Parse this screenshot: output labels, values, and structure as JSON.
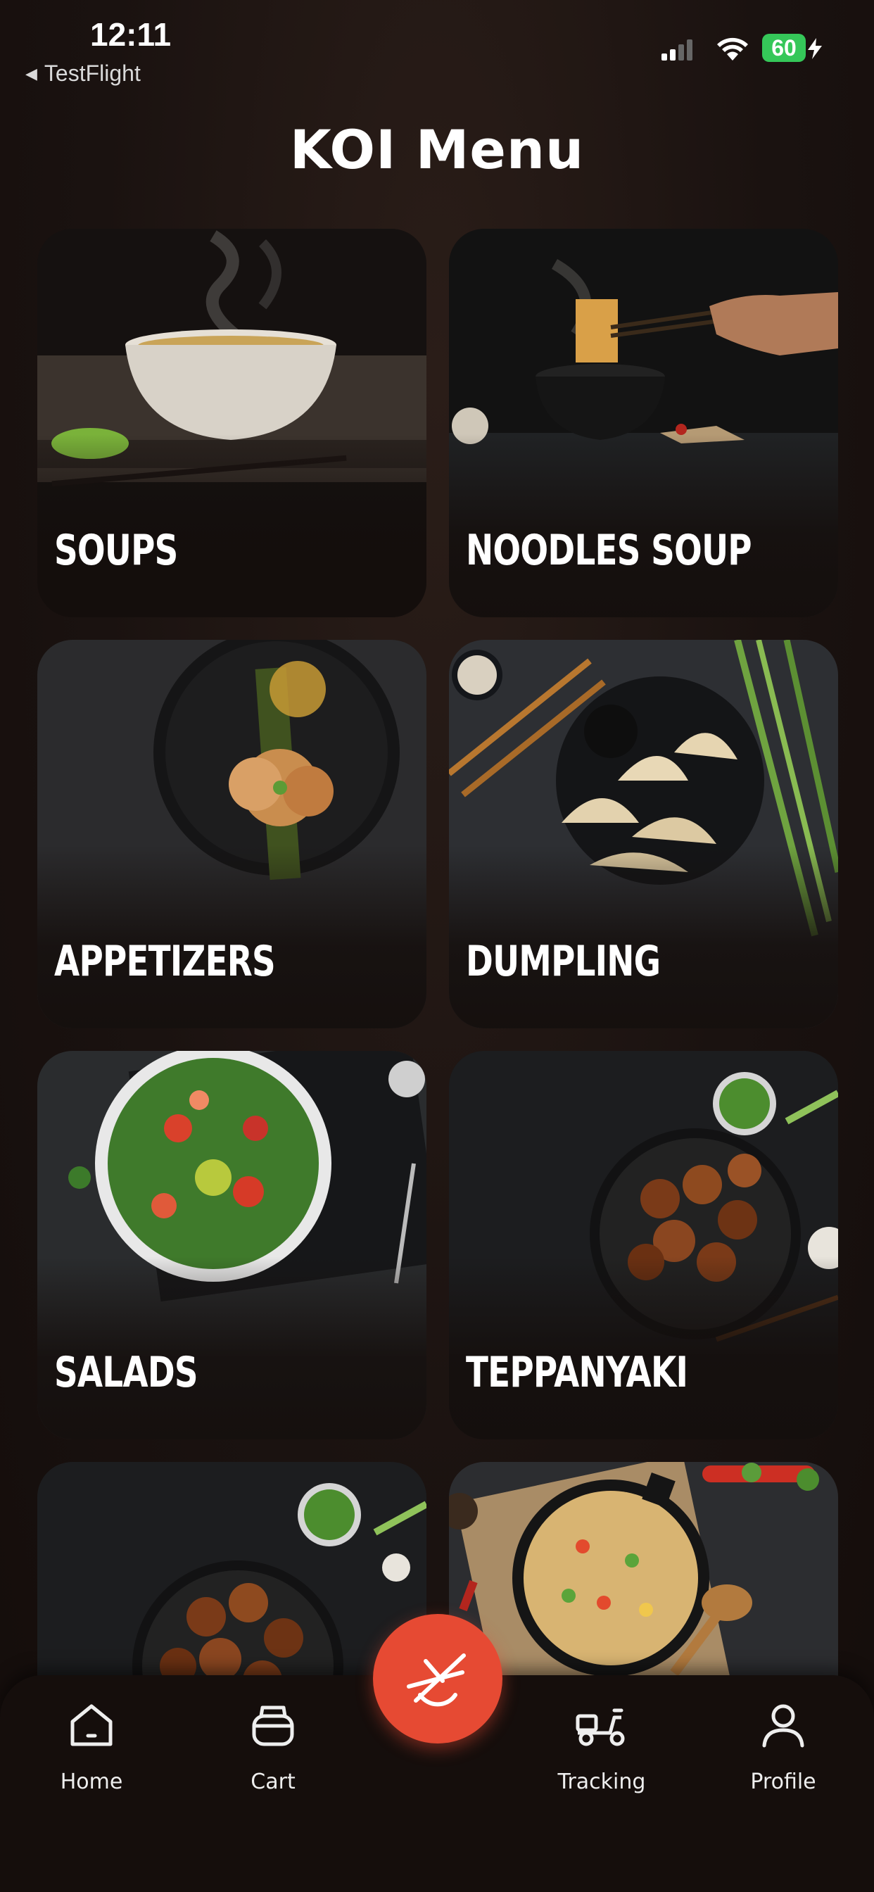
{
  "status_bar": {
    "time": "12:11",
    "back_app": "TestFlight",
    "battery": "60"
  },
  "header": {
    "title": "KOI Menu"
  },
  "categories": [
    {
      "label": "SOUPS"
    },
    {
      "label": "NOODLES SOUP"
    },
    {
      "label": "APPETIZERS"
    },
    {
      "label": "DUMPLING"
    },
    {
      "label": "SALADS"
    },
    {
      "label": "TEPPANYAKI"
    },
    {
      "label": ""
    },
    {
      "label": ""
    }
  ],
  "nav": {
    "home": "Home",
    "cart": "Cart",
    "tracking": "Tracking",
    "profile": "Profile"
  },
  "colors": {
    "accent": "#e64a33",
    "background": "#1a1210",
    "battery": "#35c759"
  },
  "icons": {
    "center_button": "chopsticks-bowl-icon"
  }
}
